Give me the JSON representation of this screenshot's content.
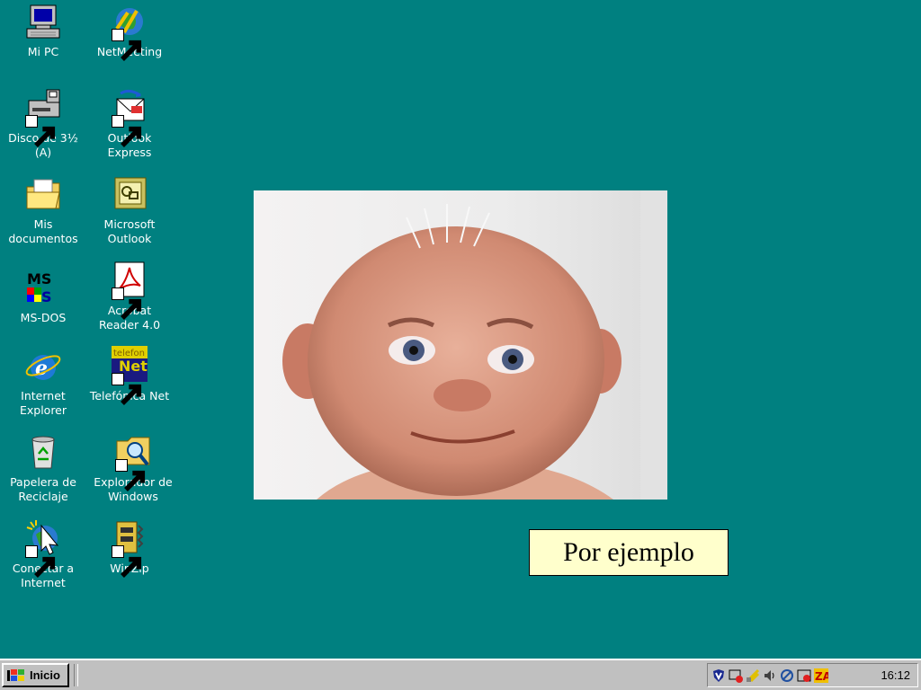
{
  "desktop": {
    "background_color": "#008080",
    "icons": [
      {
        "label": "Mi PC",
        "icon": "my-computer-icon"
      },
      {
        "label": "NetMeeting",
        "icon": "netmeeting-icon"
      },
      {
        "label": "Disco de 3½\n(A)",
        "icon": "floppy-drive-icon"
      },
      {
        "label": "Outlook\nExpress",
        "icon": "outlook-express-icon"
      },
      {
        "label": "Mis\ndocumentos",
        "icon": "my-documents-icon"
      },
      {
        "label": "Microsoft\nOutlook",
        "icon": "microsoft-outlook-icon"
      },
      {
        "label": "MS-DOS",
        "icon": "ms-dos-icon"
      },
      {
        "label": "Acrobat\nReader 4.0",
        "icon": "acrobat-reader-icon"
      },
      {
        "label": "Internet\nExplorer",
        "icon": "internet-explorer-icon"
      },
      {
        "label": "Telefónica Net",
        "icon": "telefonica-net-icon"
      },
      {
        "label": "Papelera de\nReciclaje",
        "icon": "recycle-bin-icon"
      },
      {
        "label": "Explorador de\nWindows",
        "icon": "windows-explorer-icon"
      },
      {
        "label": "Conectar a\nInternet",
        "icon": "connect-internet-icon"
      },
      {
        "label": "WinZip",
        "icon": "winzip-icon"
      }
    ]
  },
  "callout": {
    "text": "Por ejemplo"
  },
  "taskbar": {
    "start_label": "Inicio",
    "clock": "16:12",
    "tray_icons": [
      "antivirus-shield-icon",
      "media-icon",
      "network-icon",
      "volume-icon",
      "connection-icon",
      "firewall-icon",
      "zonealarm-icon"
    ]
  }
}
